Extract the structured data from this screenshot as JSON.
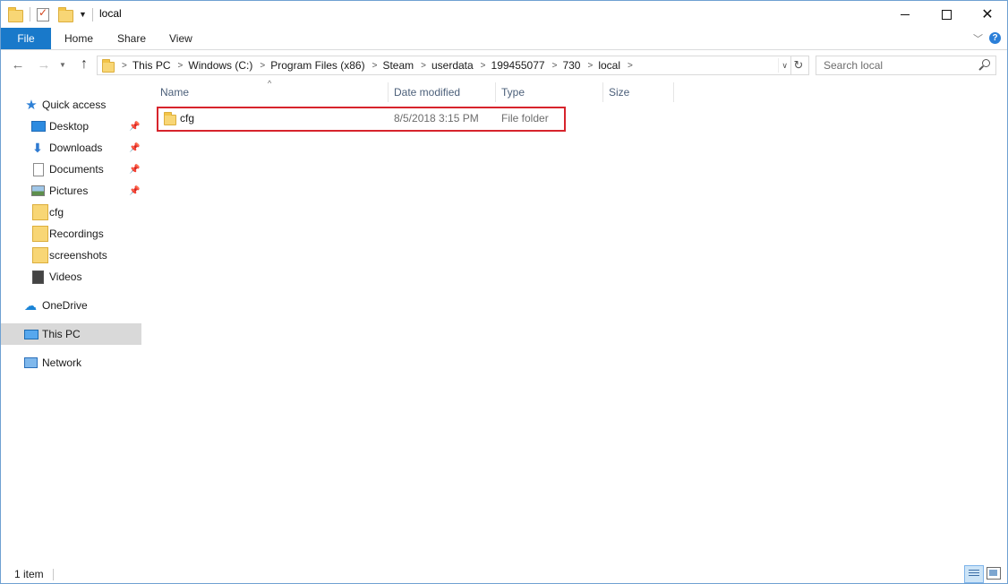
{
  "window": {
    "title": "local"
  },
  "ribbon": {
    "tabs": [
      "File",
      "Home",
      "Share",
      "View"
    ]
  },
  "address": {
    "breadcrumbs": [
      "This PC",
      "Windows (C:)",
      "Program Files (x86)",
      "Steam",
      "userdata",
      "199455077",
      "730",
      "local"
    ]
  },
  "search": {
    "placeholder": "Search local"
  },
  "nav_pane": {
    "quick_access": "Quick access",
    "pinned": [
      "Desktop",
      "Downloads",
      "Documents",
      "Pictures"
    ],
    "recent": [
      "cfg",
      "Recordings",
      "screenshots",
      "Videos"
    ],
    "onedrive": "OneDrive",
    "this_pc": "This PC",
    "network": "Network"
  },
  "columns": {
    "name": "Name",
    "date_modified": "Date modified",
    "type": "Type",
    "size": "Size"
  },
  "files": [
    {
      "name": "cfg",
      "date_modified": "8/5/2018 3:15 PM",
      "type": "File folder",
      "size": ""
    }
  ],
  "status": {
    "item_count": "1 item"
  },
  "colors": {
    "file_tab": "#1979ca",
    "highlight_border": "#d7242c",
    "selected_nav": "#d9d9d9"
  },
  "icons": [
    "folder-icon",
    "properties-icon",
    "back-arrow-icon",
    "forward-arrow-icon",
    "up-arrow-icon",
    "refresh-icon",
    "search-icon",
    "star-icon",
    "desktop-icon",
    "download-icon",
    "documents-icon",
    "pictures-icon",
    "videos-icon",
    "onedrive-icon",
    "this-pc-icon",
    "network-icon",
    "pin-icon"
  ]
}
